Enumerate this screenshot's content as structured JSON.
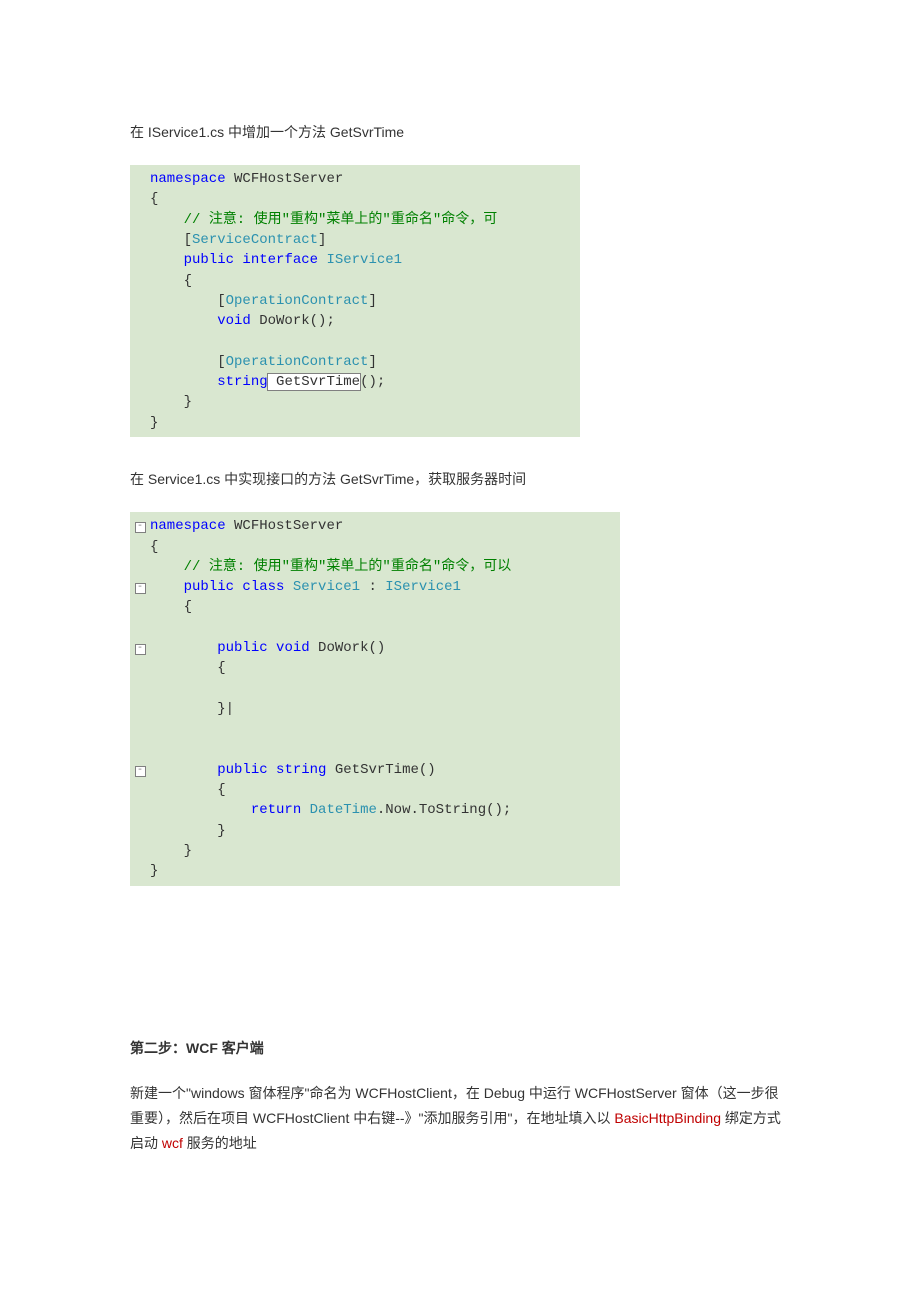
{
  "intro1": "在 IService1.cs 中增加一个方法 GetSvrTime",
  "code1": {
    "ns_kw": "namespace",
    "ns_name": " WCFHostServer",
    "br_open": "{",
    "comment_prefix": "    // ",
    "comment_text": "注意: 使用\"重构\"菜单上的\"重命名\"命令，可",
    "attr_line": "    [",
    "attr_name": "ServiceContract",
    "attr_close": "]",
    "pub_kw": "public",
    "intf_kw": " interface ",
    "intf_name": "IService1",
    "br_open2": "    {",
    "op_attr_open": "        [",
    "op_attr_name": "OperationContract",
    "op_attr_close": "]",
    "void_kw": "void",
    "dowork": " DoWork();",
    "string_kw": "string",
    "get_call": " GetSvrTime",
    "get_suffix": "();",
    "br_close2": "    }",
    "br_close1": "}"
  },
  "intro2": "在 Service1.cs 中实现接口的方法 GetSvrTime，获取服务器时间",
  "code2": {
    "ns_kw": "namespace",
    "ns_name": " WCFHostServer",
    "br_open": "{",
    "comment_prefix": "    // ",
    "comment_text": "注意: 使用\"重构\"菜单上的\"重命名\"命令，可以",
    "pub_kw": "public",
    "class_kw": " class ",
    "class_name": "Service1",
    "colon": " : ",
    "intf_name": "IService1",
    "br_open2": "    {",
    "void_kw": "void",
    "dowork_sig": " DoWork()",
    "br_open3": "        {",
    "br_close3": "        }",
    "string_kw": "string",
    "get_sig": " GetSvrTime()",
    "br_open4": "        {",
    "return_kw": "return",
    "ret_space": " ",
    "datetime": "DateTime",
    "now_call": ".Now.ToString();",
    "br_close4": "        }",
    "br_close2": "    }",
    "br_close1": "}"
  },
  "heading2": "第二步：WCF 客户端",
  "body2a": "新建一个\"windows 窗体程序\"命名为 WCFHostClient，在 Debug 中运行 WCFHostServer 窗体（这一步很重要），然后在项目 WCFHostClient 中右键--》\"添加服务引用\"，在地址填入以 ",
  "body2_red1": "BasicHttpBinding",
  "body2b": " 绑定方式启动 ",
  "body2_red2": "wcf",
  "body2c": " 服务的地址",
  "fold_minus": "-"
}
